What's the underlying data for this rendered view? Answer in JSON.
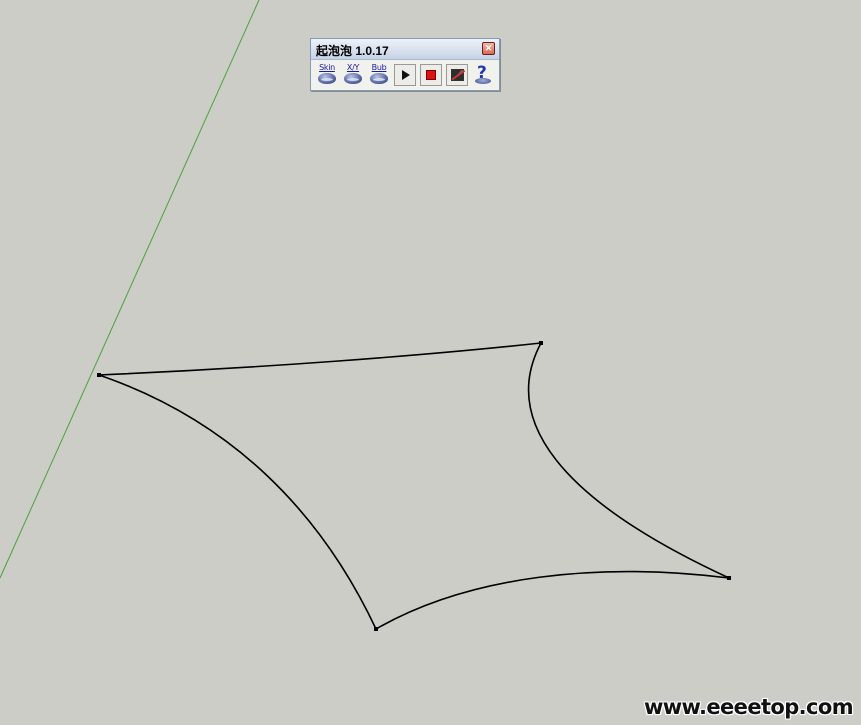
{
  "viewport": {
    "background_color": "#cdcdc8",
    "axis_color": "#4aa33a",
    "edge_color": "#000000"
  },
  "toolbar": {
    "title": "起泡泡 1.0.17",
    "close_icon": "close-icon",
    "buttons": [
      {
        "name": "skin-button",
        "label": "Skin",
        "icon": "bubble-icon"
      },
      {
        "name": "xy-button",
        "label": "X/Y",
        "icon": "bubble-icon"
      },
      {
        "name": "bub-button",
        "label": "Bub",
        "icon": "bubble-icon"
      },
      {
        "name": "play-button",
        "label": "",
        "icon": "play-icon"
      },
      {
        "name": "stop-button",
        "label": "",
        "icon": "stop-icon"
      },
      {
        "name": "material-button",
        "label": "",
        "icon": "material-icon"
      },
      {
        "name": "help-button",
        "label": "",
        "icon": "help-icon"
      }
    ],
    "stop_color": "#e01010"
  },
  "watermark": {
    "text": "www.eeeetop.com"
  }
}
